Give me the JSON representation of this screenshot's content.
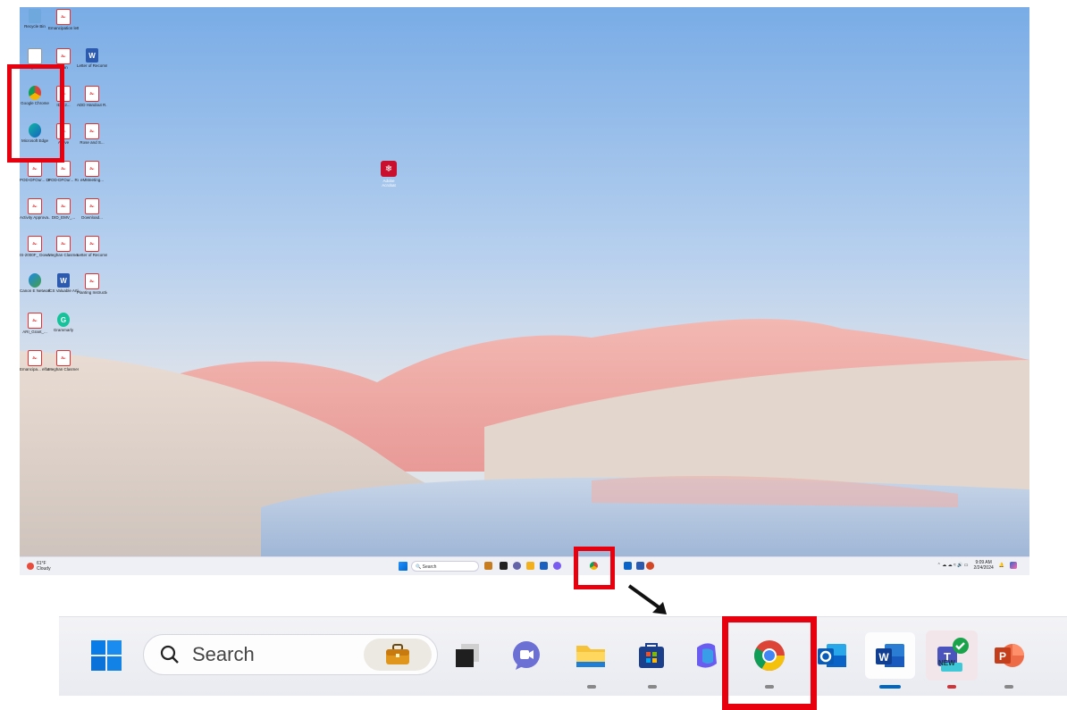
{
  "desktop": {
    "icons": [
      {
        "label": "Recycle Bin",
        "kind": "bin"
      },
      {
        "label": "Emancipation letter",
        "kind": "pdf"
      },
      {
        "label": "my files",
        "kind": "file"
      },
      {
        "label": "scan",
        "kind": "pdf"
      },
      {
        "label": "Letter of Recommen...",
        "kind": "word"
      },
      {
        "label": "Google Chrome",
        "kind": "chrome"
      },
      {
        "label": "IDS-2...",
        "kind": "pdf"
      },
      {
        "label": "ADD Handout R...",
        "kind": "pdf"
      },
      {
        "label": "Microsoft Edge",
        "kind": "edge"
      },
      {
        "label": "Active",
        "kind": "pdf"
      },
      {
        "label": "Rose and S...",
        "kind": "pdf"
      },
      {
        "label": "POD-DFOur... Download...",
        "kind": "pdf"
      },
      {
        "label": "POD-DFOur... Rose and ...",
        "kind": "pdf"
      },
      {
        "label": "eMMeeting...",
        "kind": "pdf"
      },
      {
        "label": "Activity Approva...",
        "kind": "pdf"
      },
      {
        "label": "DID_EMV_...",
        "kind": "pdf"
      },
      {
        "label": "Download...",
        "kind": "pdf"
      },
      {
        "label": "IS-2000F_ Download...",
        "kind": "pdf"
      },
      {
        "label": "Meghan Clasmen E...",
        "kind": "pdf"
      },
      {
        "label": "Letter of Recomme...",
        "kind": "pdf"
      },
      {
        "label": "Canon E Network Tool",
        "kind": "canon"
      },
      {
        "label": "ICS Valuable Article_Mi...",
        "kind": "word"
      },
      {
        "label": "Planting Instructions",
        "kind": "pdf"
      },
      {
        "label": "ARI_Grant_...",
        "kind": "pdf"
      },
      {
        "label": "Grammarly",
        "kind": "grammarly"
      },
      {
        "label": "Emancipa... elfare letter...",
        "kind": "pdf"
      },
      {
        "label": "Meghan Clasmen -...",
        "kind": "pdf"
      }
    ],
    "acrobat_label": "Adobe Acrobat",
    "weather": {
      "temp": "61°F",
      "condition": "Cloudy"
    },
    "mini_search": "Search",
    "clock": {
      "time": "9:09 AM",
      "date": "2/24/2024"
    }
  },
  "taskbar": {
    "search_placeholder": "Search",
    "apps": [
      {
        "name": "start",
        "icon": "windows-logo"
      },
      {
        "name": "work",
        "icon": "briefcase-icon"
      },
      {
        "name": "task-view",
        "icon": "task-view-icon"
      },
      {
        "name": "meet",
        "icon": "meet-now-icon"
      },
      {
        "name": "file-explorer",
        "icon": "folder-icon"
      },
      {
        "name": "store",
        "icon": "store-icon"
      },
      {
        "name": "copilot",
        "icon": "copilot-icon"
      },
      {
        "name": "chrome",
        "icon": "chrome-icon"
      },
      {
        "name": "outlook",
        "icon": "outlook-icon"
      },
      {
        "name": "word",
        "icon": "word-icon"
      },
      {
        "name": "teams",
        "icon": "teams-icon",
        "badge": "NEW"
      },
      {
        "name": "powerpoint",
        "icon": "powerpoint-icon"
      }
    ]
  },
  "colors": {
    "highlight": "#e8000f",
    "accent": "#0067c0"
  }
}
